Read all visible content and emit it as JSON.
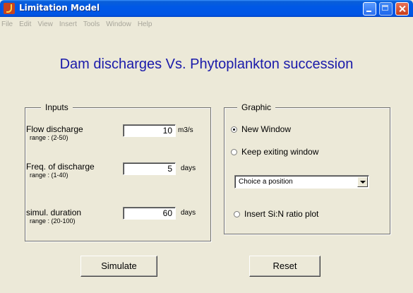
{
  "window": {
    "title": "Limitation Model"
  },
  "menu": [
    "File",
    "Edit",
    "View",
    "Insert",
    "Tools",
    "Window",
    "Help"
  ],
  "heading": "Dam discharges Vs. Phytoplankton succession",
  "inputs": {
    "title": "Inputs",
    "fields": [
      {
        "label": "Flow discharge",
        "range": "range : (2-50)",
        "value": "10",
        "unit": "m3/s"
      },
      {
        "label": "Freq. of discharge",
        "range": "range : (1-40)",
        "value": "5",
        "unit": "days"
      },
      {
        "label": "simul. duration",
        "range": "range : (20-100)",
        "value": "60",
        "unit": "days"
      }
    ]
  },
  "graphic": {
    "title": "Graphic",
    "radio_new_window": "New Window",
    "radio_keep_window": "Keep exiting window",
    "position_select": "Choice a position",
    "radio_sin_plot": "Insert Si:N ratio plot",
    "selected": "New Window"
  },
  "buttons": {
    "simulate": "Simulate",
    "reset": "Reset"
  },
  "colors": {
    "heading": "#1a1aaa",
    "titlebar": "#0055e5",
    "background": "#ece9d8"
  }
}
